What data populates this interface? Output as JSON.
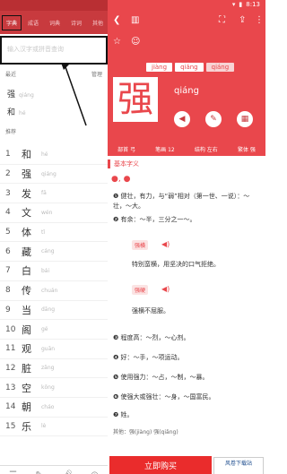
{
  "status": {
    "time": "8:13",
    "icons": [
      "signal-icon",
      "wifi-icon",
      "battery-icon"
    ]
  },
  "drawer": {
    "tabs": [
      "字典",
      "成语",
      "词典",
      "诗词",
      "其他"
    ],
    "active_tab": 0,
    "search_placeholder": "输入汉字或拼音查询",
    "history_label": "最近",
    "manage_label": "管理",
    "history": [
      {
        "char": "强",
        "py": "qiáng"
      },
      {
        "char": "和",
        "py": "hé"
      }
    ],
    "list_label": "推荐",
    "ranks": [
      {
        "n": "1",
        "c": "和",
        "py": "hé"
      },
      {
        "n": "2",
        "c": "强",
        "py": "qiáng"
      },
      {
        "n": "3",
        "c": "发",
        "py": "fā"
      },
      {
        "n": "4",
        "c": "文",
        "py": "wén"
      },
      {
        "n": "5",
        "c": "体",
        "py": "tǐ"
      },
      {
        "n": "6",
        "c": "藏",
        "py": "cáng"
      },
      {
        "n": "7",
        "c": "白",
        "py": "bái"
      },
      {
        "n": "8",
        "c": "传",
        "py": "chuán"
      },
      {
        "n": "9",
        "c": "当",
        "py": "dāng"
      },
      {
        "n": "10",
        "c": "阁",
        "py": "gé"
      },
      {
        "n": "11",
        "c": "观",
        "py": "guān"
      },
      {
        "n": "12",
        "c": "脏",
        "py": "zāng"
      },
      {
        "n": "13",
        "c": "空",
        "py": "kōng"
      },
      {
        "n": "14",
        "c": "朝",
        "py": "cháo"
      },
      {
        "n": "15",
        "c": "乐",
        "py": "lè"
      }
    ],
    "bottom_icons": [
      "list-icon",
      "edit-icon",
      "mic-icon",
      "camera-icon"
    ]
  },
  "main": {
    "char": "强",
    "pinyin_tabs": [
      "jiàng",
      "qiǎng",
      "qiáng"
    ],
    "selected_tab": 2,
    "pinyin": "qiáng",
    "info_bar": [
      "部首 弓",
      "笔画 12",
      "结构 左右",
      "繁体 强"
    ],
    "section_title": "基本字义",
    "defs": [
      {
        "text": "❶ 健壮，有力，与“弱”相对（第一世、一说）：～壮，～大。"
      },
      {
        "text": "❷ 有余：～半，三分之一～。"
      }
    ],
    "examples": [
      {
        "tag": "强横",
        "text": "特别蛮横，用坚决的口气拒绝。"
      },
      {
        "tag": "强硬",
        "text": "强横不屈服。"
      }
    ],
    "defs2": [
      "❸ 程度高：～烈，～心剂。",
      "❹ 好：～手，～项运动。",
      "❺ 使用强力：～占，～制，～暴。",
      "❻ 使强大或强壮：～身，～国富民。",
      "❼ 姓。"
    ],
    "related": "其他：强(jiàng) 强(qiǎng)",
    "cta": "立即购买",
    "brand": "风卷下载站"
  }
}
